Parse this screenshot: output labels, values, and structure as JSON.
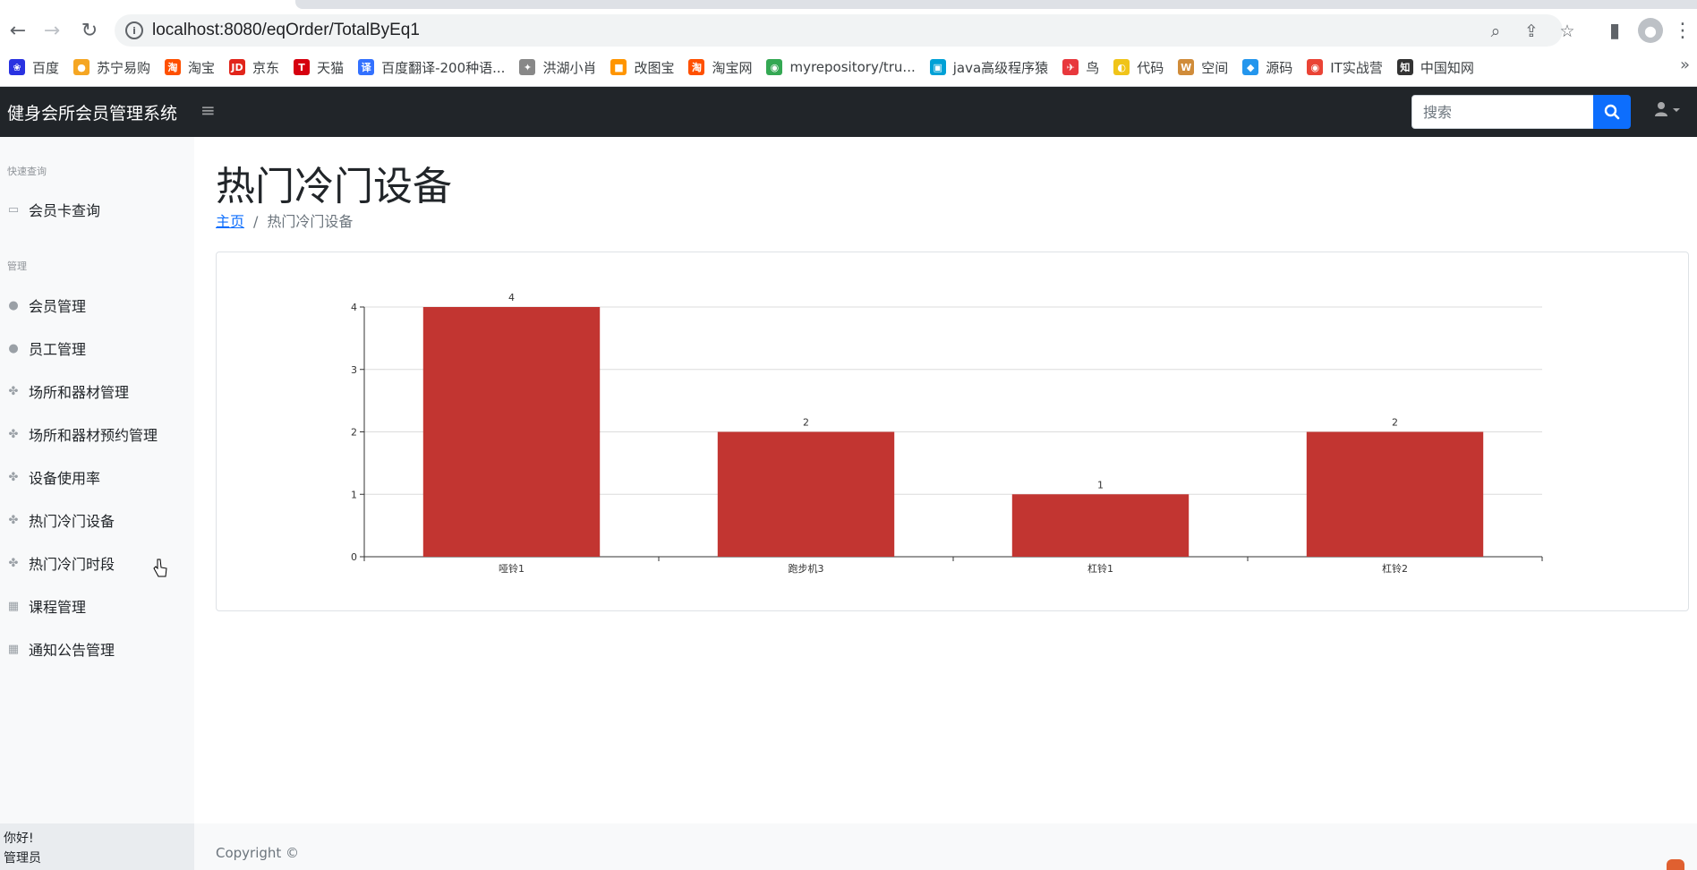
{
  "browser": {
    "url": "localhost:8080/eqOrder/TotalByEq1",
    "bookmarks": [
      {
        "label": "百度",
        "icon": "baidu-icon",
        "color": "#2932e1",
        "glyph": "❀"
      },
      {
        "label": "苏宁易购",
        "icon": "suning-icon",
        "color": "#f5a623",
        "glyph": "●"
      },
      {
        "label": "淘宝",
        "icon": "taobao-icon",
        "color": "#ff5000",
        "glyph": "淘"
      },
      {
        "label": "京东",
        "icon": "jd-icon",
        "color": "#e1251b",
        "glyph": "JD"
      },
      {
        "label": "天猫",
        "icon": "tmall-icon",
        "color": "#d6000f",
        "glyph": "T"
      },
      {
        "label": "百度翻译-200种语...",
        "icon": "translate-icon",
        "color": "#3371ff",
        "glyph": "译"
      },
      {
        "label": "洪湖小肖",
        "icon": "bird-icon",
        "color": "#888888",
        "glyph": "✦"
      },
      {
        "label": "改图宝",
        "icon": "gaitubao-icon",
        "color": "#ff9500",
        "glyph": "■"
      },
      {
        "label": "淘宝网",
        "icon": "taobao-icon",
        "color": "#ff5000",
        "glyph": "淘"
      },
      {
        "label": "myrepository/tru...",
        "icon": "chrome-icon",
        "color": "#34a853",
        "glyph": "◉"
      },
      {
        "label": "java高级程序猿",
        "icon": "bilibili-icon",
        "color": "#00a1d6",
        "glyph": "▣"
      },
      {
        "label": "鸟",
        "icon": "bird-red-icon",
        "color": "#e8383d",
        "glyph": "✈"
      },
      {
        "label": "代码",
        "icon": "code-icon",
        "color": "#f0c419",
        "glyph": "◐"
      },
      {
        "label": "空间",
        "icon": "space-icon",
        "color": "#d08c3a",
        "glyph": "W"
      },
      {
        "label": "源码",
        "icon": "docker-icon",
        "color": "#2496ed",
        "glyph": "◆"
      },
      {
        "label": "IT实战营",
        "icon": "chrome-red-icon",
        "color": "#ea4335",
        "glyph": "◉"
      },
      {
        "label": "中国知网",
        "icon": "cnki-icon",
        "color": "#333333",
        "glyph": "知"
      }
    ]
  },
  "app": {
    "brand": "健身会所会员管理系统",
    "search_placeholder": "搜索",
    "sidebar": {
      "section_quick": "快速查询",
      "section_manage": "管理",
      "quick_items": [
        {
          "label": "会员卡查询",
          "icon": "card-icon"
        }
      ],
      "manage_items": [
        {
          "label": "会员管理",
          "icon": "user-icon"
        },
        {
          "label": "员工管理",
          "icon": "user-icon"
        },
        {
          "label": "场所和器材管理",
          "icon": "equipment-icon"
        },
        {
          "label": "场所和器材预约管理",
          "icon": "equipment-icon"
        },
        {
          "label": "设备使用率",
          "icon": "equipment-icon"
        },
        {
          "label": "热门冷门设备",
          "icon": "equipment-icon"
        },
        {
          "label": "热门冷门时段",
          "icon": "equipment-icon"
        },
        {
          "label": "课程管理",
          "icon": "calendar-icon"
        },
        {
          "label": "通知公告管理",
          "icon": "calendar-icon"
        }
      ],
      "footer_greeting": "你好!",
      "footer_role": "管理员"
    },
    "page_title": "热门冷门设备",
    "breadcrumb": {
      "home": "主页",
      "current": "热门冷门设备"
    },
    "footer_copyright": "Copyright ©"
  },
  "colors": {
    "bar": "#c23531",
    "navbar": "#212529",
    "primary": "#0d6efd"
  },
  "chart_data": {
    "type": "bar",
    "categories": [
      "哑铃1",
      "跑步机3",
      "杠铃1",
      "杠铃2"
    ],
    "values": [
      4,
      2,
      1,
      2
    ],
    "yticks": [
      0,
      1,
      2,
      3,
      4
    ],
    "ylim": [
      0,
      4
    ],
    "grid": true,
    "data_labels": true
  }
}
